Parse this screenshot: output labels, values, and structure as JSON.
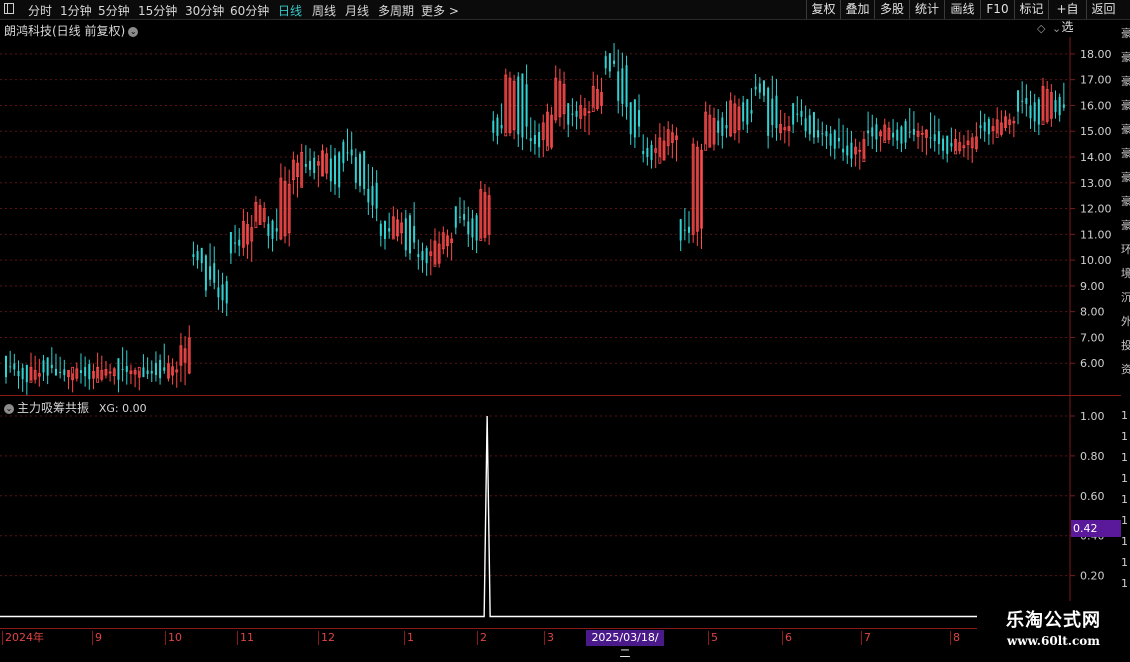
{
  "toolbar": {
    "periods": [
      "分时",
      "1分钟",
      "5分钟",
      "15分钟",
      "30分钟",
      "60分钟",
      "日线",
      "周线",
      "月线",
      "多周期",
      "更多 >"
    ],
    "active_period": "日线",
    "right_buttons": [
      "复权",
      "叠加",
      "多股",
      "统计",
      "画线",
      "F10",
      "标记",
      "+自选",
      "返回"
    ]
  },
  "main_panel": {
    "title": "朗鸿科技(日线 前复权)",
    "price_axis": [
      "18.00",
      "17.00",
      "16.00",
      "15.00",
      "14.00",
      "13.00",
      "12.00",
      "11.00",
      "10.00",
      "9.00",
      "8.00",
      "7.00",
      "6.00"
    ]
  },
  "indicator_panel": {
    "title": "主力吸筹共振",
    "xg_label": "XG: 0.00",
    "axis": [
      "1.00",
      "0.80",
      "0.60",
      "0.40",
      "0.20"
    ],
    "current_tag": "0.42"
  },
  "time_axis": {
    "labels": [
      "2024年",
      "9",
      "10",
      "11",
      "12",
      "1",
      "2",
      "3",
      "5",
      "6",
      "7",
      "8"
    ],
    "cursor_date": "2025/03/18/二"
  },
  "watermark": {
    "line1": "乐淘公式网",
    "line2": "www.60lt.com"
  },
  "colors": {
    "up": "#ff4b4b",
    "down": "#32d2d2",
    "grid": "#5a1414",
    "border": "#7a1a1a",
    "signal": "#ffffff",
    "tag_bg": "#5a189a"
  },
  "chart_data": [
    {
      "type": "candlestick",
      "title": "朗鸿科技(日线 前复权)",
      "ylim": [
        5.0,
        18.5
      ],
      "x_ticks": [
        "2024年",
        "9",
        "10",
        "11",
        "12",
        "1",
        "2",
        "3",
        "5",
        "6",
        "7",
        "8"
      ],
      "close_approx": [
        5.7,
        5.5,
        5.6,
        5.7,
        5.6,
        5.6,
        5.5,
        5.6,
        5.7,
        5.6,
        5.7,
        5.6,
        5.6,
        5.8,
        6.8,
        10.0,
        9.0,
        8.5,
        10.5,
        11.5,
        12.0,
        11.0,
        13.0,
        14.0,
        13.5,
        14.0,
        13.0,
        14.0,
        13.0,
        12.0,
        11.0,
        11.5,
        10.5,
        10.0,
        10.5,
        11.0,
        11.5,
        11.0,
        12.5,
        15.0,
        17.0,
        15.0,
        14.5,
        15.5,
        17.0,
        15.5,
        16.0,
        16.5,
        17.5,
        16.0,
        15.0,
        14.0,
        14.5,
        15.0,
        11.0,
        14.5,
        15.5,
        15.0,
        16.0,
        15.5,
        16.5,
        15.0,
        15.2,
        15.5,
        15.0,
        14.8,
        14.5,
        14.0,
        14.5,
        14.8,
        15.0,
        14.7,
        14.8,
        15.0,
        14.5,
        14.3,
        14.5,
        14.6,
        15.0,
        15.2,
        15.5,
        16.0,
        15.5,
        16.5,
        15.8
      ]
    },
    {
      "type": "line",
      "title": "主力吸筹共振",
      "series": [
        {
          "name": "XG",
          "spike_index": 0.69,
          "values": [
            0,
            1,
            0
          ]
        }
      ],
      "ylim": [
        0,
        1.0
      ]
    }
  ]
}
